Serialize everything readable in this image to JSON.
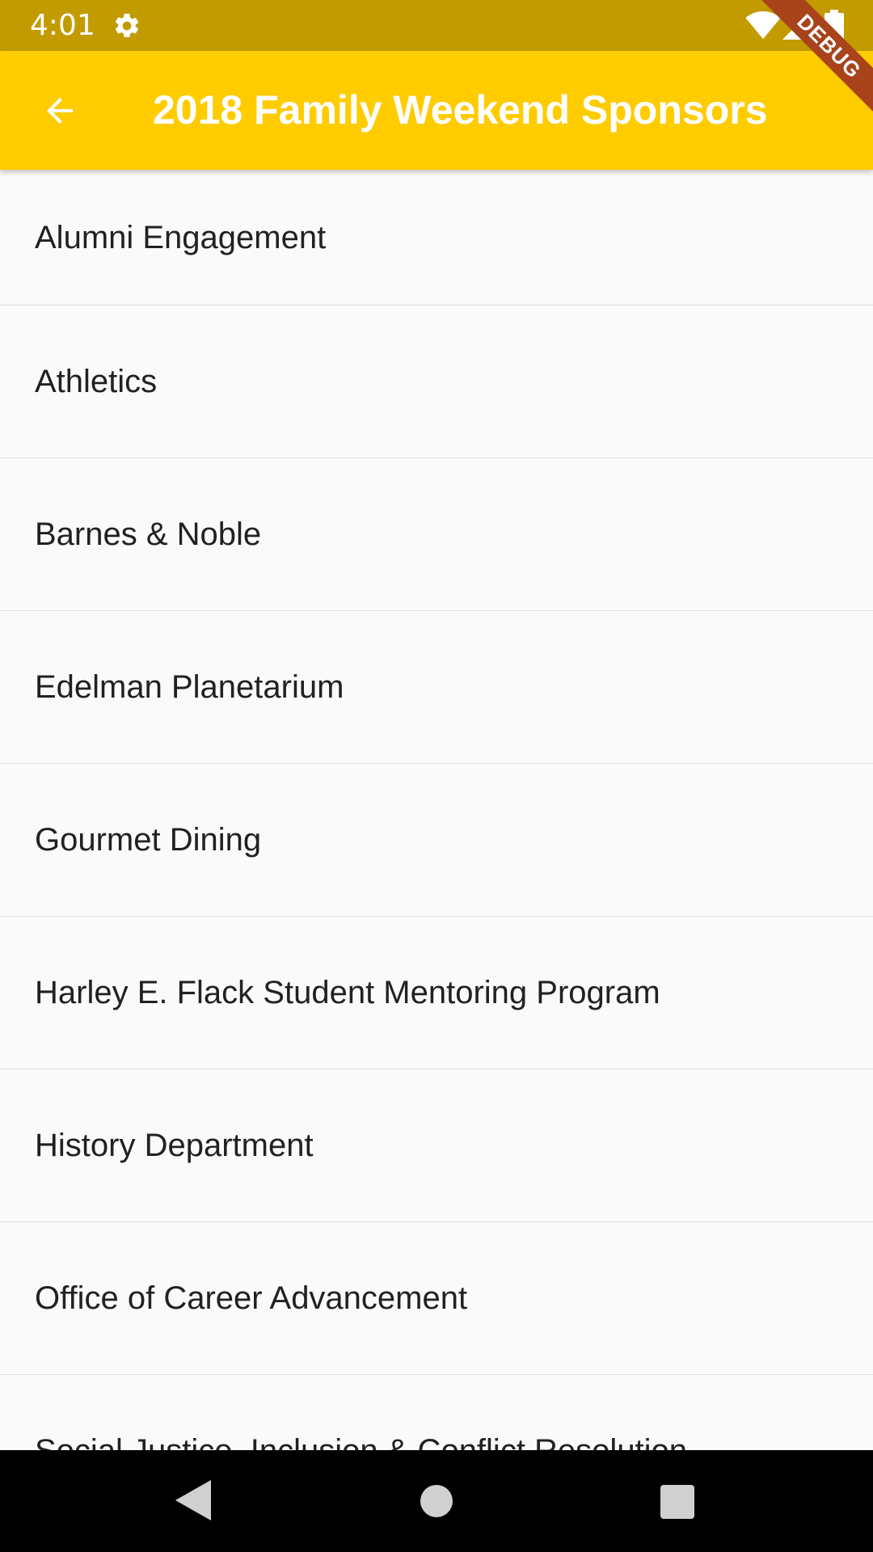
{
  "status_bar": {
    "time": "4:01",
    "background_color": "#c29b00",
    "icons": [
      "gear-icon",
      "wifi-icon",
      "cellular-signal-icon",
      "battery-icon"
    ]
  },
  "debug_banner": {
    "label": "DEBUG",
    "color": "#a8431c"
  },
  "app_bar": {
    "title": "2018 Family Weekend Sponsors",
    "background_color": "#ffcc00",
    "back_icon": "arrow-back-icon"
  },
  "sponsors": [
    {
      "label": "Alumni Engagement"
    },
    {
      "label": "Athletics"
    },
    {
      "label": "Barnes & Noble"
    },
    {
      "label": "Edelman Planetarium"
    },
    {
      "label": "Gourmet Dining"
    },
    {
      "label": "Harley E. Flack Student Mentoring Program"
    },
    {
      "label": "History Department"
    },
    {
      "label": "Office of Career Advancement"
    },
    {
      "label": "Social Justice, Inclusion & Conflict Resolution"
    }
  ],
  "nav_bar": {
    "icons": [
      "nav-back-icon",
      "nav-home-icon",
      "nav-recent-apps-icon"
    ]
  }
}
